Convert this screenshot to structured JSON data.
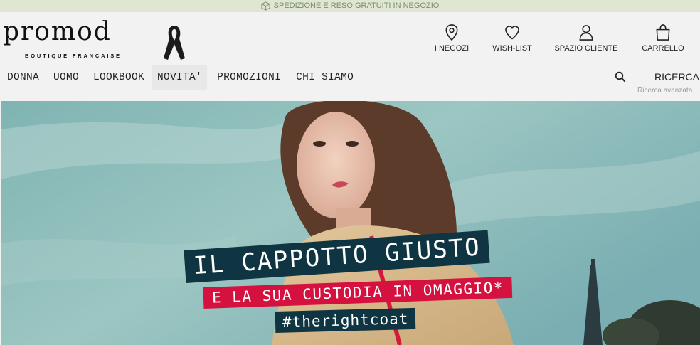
{
  "promo_bar": {
    "text": "SPEDIZIONE E RESO GRATUITI IN NEGOZIO",
    "icon": "box-icon"
  },
  "brand": {
    "name": "promod",
    "tagline": "BOUTIQUE FRANÇAISE"
  },
  "utility_nav": [
    {
      "label": "I NEGOZI",
      "icon": "map-pin-icon"
    },
    {
      "label": "WISH-LIST",
      "icon": "heart-icon"
    },
    {
      "label": "SPAZIO CLIENTE",
      "icon": "user-icon"
    },
    {
      "label": "CARRELLO",
      "icon": "shopping-bag-icon"
    }
  ],
  "main_nav": [
    {
      "label": "DONNA",
      "active": false
    },
    {
      "label": "UOMO",
      "active": false
    },
    {
      "label": "LOOKBOOK",
      "active": false
    },
    {
      "label": "NOVITA'",
      "active": true
    },
    {
      "label": "PROMOZIONI",
      "active": false
    },
    {
      "label": "CHI SIAMO",
      "active": false
    }
  ],
  "search": {
    "label": "RICERCA",
    "advanced": "Ricerca avanzata",
    "icon": "search-icon"
  },
  "hero": {
    "headline": "IL CAPPOTTO GIUSTO",
    "subheadline": "E LA SUA CUSTODIA IN OMAGGIO*",
    "hashtag": "#therightcoat"
  },
  "colors": {
    "promo_bg": "#dfe6d2",
    "header_bg": "#f2f2f2",
    "banner_dark": "#0f3542",
    "banner_red": "#d5123f",
    "sky": "#6ea5a8"
  }
}
